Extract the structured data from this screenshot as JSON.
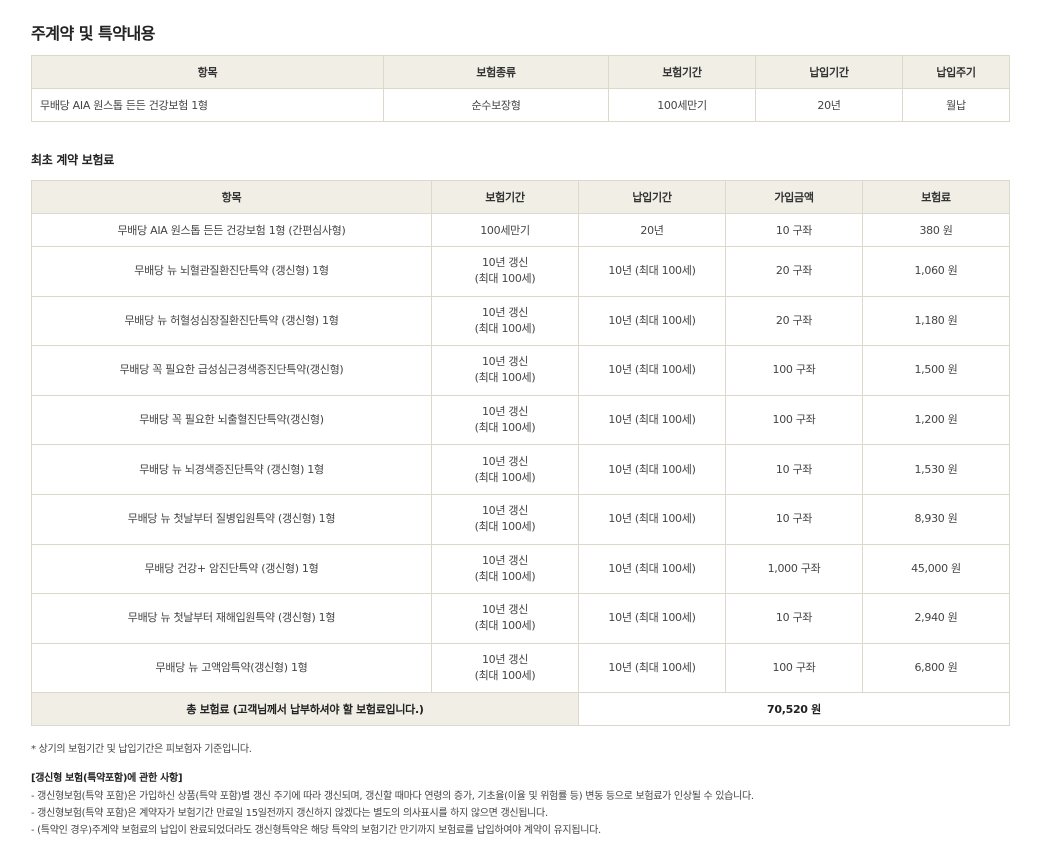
{
  "page": {
    "title": "주계약 및 특약내용",
    "premium_title": "최초 계약 보험료"
  },
  "main_table": {
    "headers": [
      "항목",
      "보험종류",
      "보험기간",
      "납입기간",
      "납입주기"
    ],
    "row": [
      "무배당 AIA 원스톱 든든 건강보험 1형",
      "순수보장형",
      "100세만기",
      "20년",
      "월납"
    ]
  },
  "premium_table": {
    "headers": [
      "항목",
      "보험기간",
      "납입기간",
      "가입금액",
      "보험료"
    ],
    "first_row": [
      "무배당 AIA 원스톱 든든 건강보험 1형 (간편심사형)",
      "100세만기",
      "20년",
      "10 구좌",
      "380 원"
    ],
    "rows": [
      {
        "name": "무배당 뉴 뇌혈관질환진단특약 (갱신형) 1형",
        "period_1": "10년 갱신",
        "period_2": "(최대 100세)",
        "pay": "10년 (최대 100세)",
        "amount": "20 구좌",
        "premium": "1,060 원"
      },
      {
        "name": "무배당 뉴 허혈성심장질환진단특약 (갱신형) 1형",
        "period_1": "10년 갱신",
        "period_2": "(최대 100세)",
        "pay": "10년 (최대 100세)",
        "amount": "20 구좌",
        "premium": "1,180 원"
      },
      {
        "name": "무배당 꼭 필요한 급성심근경색증진단특약(갱신형)",
        "period_1": "10년 갱신",
        "period_2": "(최대 100세)",
        "pay": "10년 (최대 100세)",
        "amount": "100 구좌",
        "premium": "1,500 원"
      },
      {
        "name": "무배당 꼭 필요한 뇌출혈진단특약(갱신형)",
        "period_1": "10년 갱신",
        "period_2": "(최대 100세)",
        "pay": "10년 (최대 100세)",
        "amount": "100 구좌",
        "premium": "1,200 원"
      },
      {
        "name": "무배당 뉴 뇌경색증진단특약 (갱신형) 1형",
        "period_1": "10년 갱신",
        "period_2": "(최대 100세)",
        "pay": "10년 (최대 100세)",
        "amount": "10 구좌",
        "premium": "1,530 원"
      },
      {
        "name": "무배당 뉴 첫날부터 질병입원특약 (갱신형) 1형",
        "period_1": "10년 갱신",
        "period_2": "(최대 100세)",
        "pay": "10년 (최대 100세)",
        "amount": "10 구좌",
        "premium": "8,930 원"
      },
      {
        "name": "무배당 건강+ 암진단특약 (갱신형) 1형",
        "period_1": "10년 갱신",
        "period_2": "(최대 100세)",
        "pay": "10년 (최대 100세)",
        "amount": "1,000 구좌",
        "premium": "45,000 원"
      },
      {
        "name": "무배당 뉴 첫날부터 재해입원특약 (갱신형) 1형",
        "period_1": "10년 갱신",
        "period_2": "(최대 100세)",
        "pay": "10년 (최대 100세)",
        "amount": "10 구좌",
        "premium": "2,940 원"
      },
      {
        "name": "무배당 뉴 고액암특약(갱신형) 1형",
        "period_1": "10년 갱신",
        "period_2": "(최대 100세)",
        "pay": "10년 (최대 100세)",
        "amount": "100 구좌",
        "premium": "6,800 원"
      }
    ],
    "total_label": "총 보험료 (고객님께서 납부하셔야 할 보험료입니다.)",
    "total_value": "70,520 원"
  },
  "notes": {
    "basis": "* 상기의 보험기간 및 납입기간은 피보험자 기준입니다.",
    "renewal_title": "[갱신형 보험(특약포함)에 관한 사항]",
    "renewal_1": "- 갱신형보험(특약 포함)은 가입하신 상품(특약 포함)별 갱신 주기에 따라 갱신되며, 갱신할 때마다 연령의 증가, 기초율(이율 및 위험률 등) 변동 등으로 보험료가 인상될 수 있습니다.",
    "renewal_2": "- 갱신형보험(특약 포함)은 계약자가 보험기간 만료일 15일전까지 갱신하지 않겠다는 별도의 의사표시를 하지 않으면 갱신됩니다.",
    "renewal_3": "- (특약인 경우)주계약 보험료의 납입이 완료되었더라도 갱신형특약은 해당 특약의 보험기간 만기까지 보험료를 납입하여야 계약이 유지됩니다."
  }
}
